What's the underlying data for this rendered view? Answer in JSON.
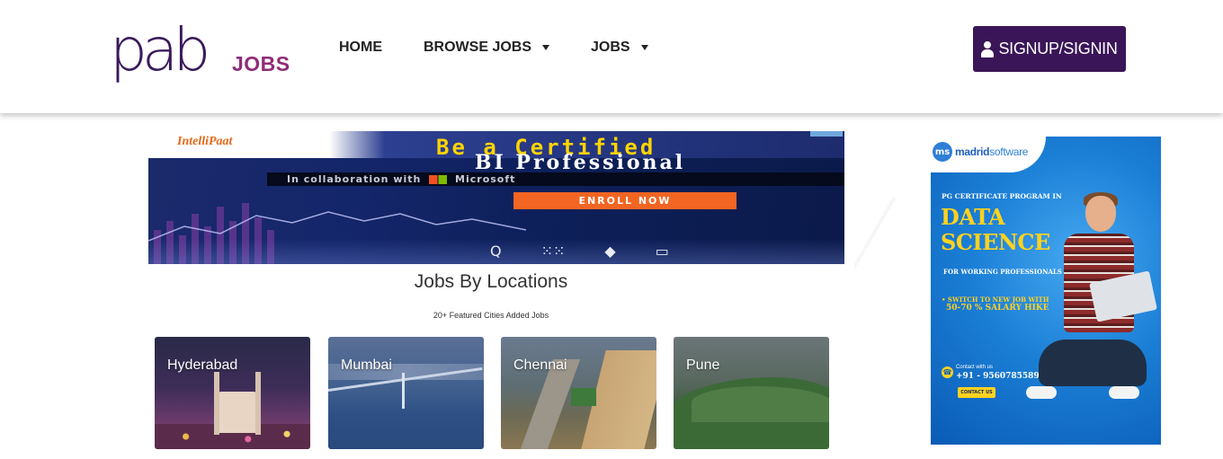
{
  "header": {
    "logo_mark": "pab",
    "logo_suffix": "JOBS",
    "nav": {
      "home": "HOME",
      "browse_jobs": "BROWSE JOBS",
      "jobs": "JOBS"
    },
    "signup_label": "SIGNUP/SIGNIN"
  },
  "ad_top": {
    "brand": "IntelliPaat",
    "line1": "Be a Certified",
    "line2": "BI Professional",
    "line3_prefix": "In collaboration with",
    "line3_brand": "Microsoft",
    "cta": "ENROLL NOW",
    "icons": [
      "Q",
      "⁙⁙",
      "◆",
      "▭"
    ]
  },
  "section": {
    "title": "Jobs By Locations",
    "subtitle": "20+ Featured Cities Added Jobs"
  },
  "cities": [
    {
      "name": "Hyderabad"
    },
    {
      "name": "Mumbai"
    },
    {
      "name": "Chennai"
    },
    {
      "name": "Pune"
    }
  ],
  "ad_side": {
    "brand_logo": "ms",
    "brand_bold": "madrid",
    "brand_light": "software",
    "cert": "PG CERTIFICATE PROGRAM IN",
    "title_line1": "DATA",
    "title_line2": "SCIENCE",
    "audience": "FOR WORKING PROFESSIONALS",
    "switch_line1": "• SWITCH TO NEW JOB WITH",
    "switch_line2": "50-70 % SALARY HIKE",
    "contact_label": "Contact with us",
    "phone": "+91 - 9560785589",
    "contact_button": "CONTACT US"
  },
  "colors": {
    "brand_purple": "#3a1557",
    "logo_magenta": "#8e2d78",
    "ad_yellow": "#ffd21f",
    "enroll_orange": "#f26522"
  }
}
